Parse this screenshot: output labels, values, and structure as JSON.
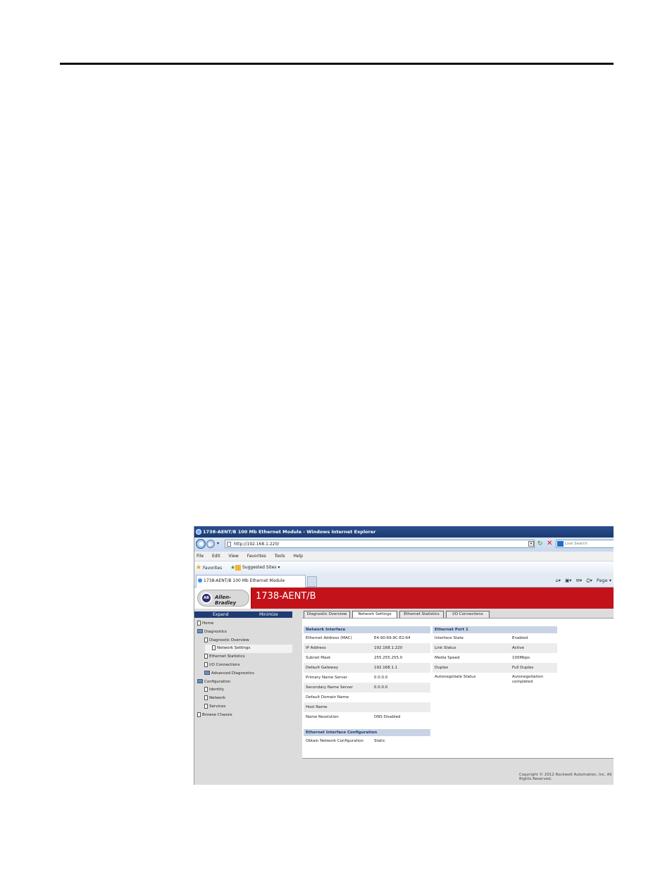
{
  "window": {
    "title": "1738-AENT/B 100 Mb Ethernet Module - Windows Internet Explorer"
  },
  "addressbar": {
    "url": "http://192.168.1.220/",
    "search_placeholder": "Live Search"
  },
  "menu": [
    "File",
    "Edit",
    "View",
    "Favorites",
    "Tools",
    "Help"
  ],
  "favorites": {
    "label": "Favorites",
    "suggested": "Suggested Sites ▾"
  },
  "browser_tab": {
    "title": "1738-AENT/B 100 Mb Ethernet Module",
    "page_label": "Page ▾"
  },
  "header": {
    "brand": "Allen-Bradley",
    "model": "1738-AENT/B"
  },
  "leftnav": {
    "expand": "Expand",
    "minimize": "Minimize",
    "items": [
      {
        "label": "Home",
        "kind": "doc",
        "level": 0
      },
      {
        "label": "Diagnostics",
        "kind": "folder",
        "level": 0
      },
      {
        "label": "Diagnostic Overview",
        "kind": "doc",
        "level": 1
      },
      {
        "label": "Network Settings",
        "kind": "doc",
        "level": 1,
        "selected": true
      },
      {
        "label": "Ethernet Statistics",
        "kind": "doc",
        "level": 1
      },
      {
        "label": "I/O Connections",
        "kind": "doc",
        "level": 1
      },
      {
        "label": "Advanced Diagnostics",
        "kind": "folder",
        "level": 1
      },
      {
        "label": "Configuration",
        "kind": "folder",
        "level": 0
      },
      {
        "label": "Identity",
        "kind": "doc",
        "level": 1
      },
      {
        "label": "Network",
        "kind": "doc",
        "level": 1
      },
      {
        "label": "Services",
        "kind": "doc",
        "level": 1
      },
      {
        "label": "Browse Chassis",
        "kind": "doc",
        "level": 0
      }
    ]
  },
  "content_tabs": [
    "Diagnostic Overview",
    "Network Settings",
    "Ethernet Statistics",
    "I/O Connections"
  ],
  "network_interface": {
    "title": "Network Interface",
    "rows": [
      {
        "key": "Ethernet Address (MAC)",
        "value": "E4:90:69:9C:E2:64"
      },
      {
        "key": "IP Address",
        "value": "192.168.1.220"
      },
      {
        "key": "Subnet Mask",
        "value": "255.255.255.0"
      },
      {
        "key": "Default Gateway",
        "value": "192.168.1.1"
      },
      {
        "key": "Primary Name Server",
        "value": "0.0.0.0"
      },
      {
        "key": "Secondary Name Server",
        "value": "0.0.0.0"
      },
      {
        "key": "Default Domain Name",
        "value": ""
      },
      {
        "key": "Host Name",
        "value": ""
      },
      {
        "key": "Name Resolution",
        "value": "DNS Disabled"
      }
    ]
  },
  "ethernet_port": {
    "title": "Ethernet Port 1",
    "rows": [
      {
        "key": "Interface State",
        "value": "Enabled"
      },
      {
        "key": "Link Status",
        "value": "Active"
      },
      {
        "key": "Media Speed",
        "value": "100Mbps"
      },
      {
        "key": "Duplex",
        "value": "Full Duplex"
      },
      {
        "key": "Autonegotiate Status",
        "value": "Autonegotiation completed"
      }
    ]
  },
  "interface_config": {
    "title": "Ethernet Interface Configuration",
    "rows": [
      {
        "key": "Obtain Network Configuration",
        "value": "Static"
      }
    ]
  },
  "footer": {
    "copyright": "Copyright © 2012 Rockwell Automation, Inc. All Rights Reserved."
  }
}
